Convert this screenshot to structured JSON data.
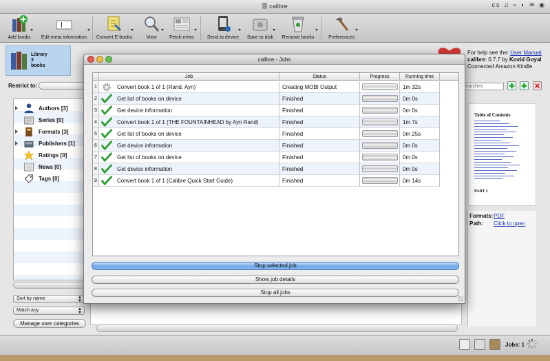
{
  "app": {
    "title": "calibre",
    "menubar_extras": "cs ♫ ⌁ ◐ ✉ ◉"
  },
  "toolbar": {
    "add_books": "Add books",
    "edit_meta": "Edit meta information",
    "convert": "Convert E-books",
    "view": "View",
    "fetch_news": "Fetch news",
    "send_device": "Send to device",
    "save_disk": "Save to disk",
    "remove": "Remove books",
    "preferences": "Preferences"
  },
  "library": {
    "label": "Library",
    "count": "3",
    "unit": "books"
  },
  "restrict": {
    "label": "Restrict to:"
  },
  "tag_browser": {
    "items": [
      {
        "label": "Authors [3]",
        "expandable": true,
        "icon": "user-icon"
      },
      {
        "label": "Series [0]",
        "expandable": false,
        "icon": "series-icon"
      },
      {
        "label": "Formats [3]",
        "expandable": true,
        "icon": "book-icon"
      },
      {
        "label": "Publishers [1]",
        "expandable": true,
        "icon": "publisher-icon"
      },
      {
        "label": "Ratings [0]",
        "expandable": false,
        "icon": "star-icon"
      },
      {
        "label": "News [0]",
        "expandable": false,
        "icon": "news-icon"
      },
      {
        "label": "Tags [0]",
        "expandable": false,
        "icon": "tag-icon"
      }
    ]
  },
  "sort_combo": {
    "value": "Sort by name"
  },
  "match_combo": {
    "value": "Match any"
  },
  "manage_button": {
    "label": "Manage user categories"
  },
  "help": {
    "prefix": "For help see the:",
    "link": "User Manual",
    "version_prefix": "calibre",
    "version": ": 0.7.7 by",
    "author": "Kovid Goyal",
    "device": "Connected Amazon Kindle"
  },
  "search": {
    "placeholder": "searches"
  },
  "cover": {
    "toc_title": "Table of Contents",
    "part_label": "PART I"
  },
  "details": {
    "formats_label": "Formats:",
    "formats_value": "PDF",
    "path_label": "Path:",
    "path_value": "Click to open"
  },
  "status": {
    "jobs": "Jobs: 1"
  },
  "jobs_dialog": {
    "title": "calibre - Jobs",
    "columns": [
      "Job",
      "Status",
      "Progress",
      "Running time"
    ],
    "rows": [
      {
        "num": "1",
        "job": "Convert book 1 of 1 (Rand, Ayn)",
        "status": "Creating MOBI Output",
        "progress": 0.75,
        "time": "1m 32s",
        "icon": "gear-icon"
      },
      {
        "num": "2",
        "job": "Get list of books on device",
        "status": "Finished",
        "progress": 1.0,
        "time": "0m 0s",
        "icon": "check-icon"
      },
      {
        "num": "3",
        "job": "Get device information",
        "status": "Finished",
        "progress": 1.0,
        "time": "0m 0s",
        "icon": "check-icon"
      },
      {
        "num": "4",
        "job": "Convert book 1 of 1 (THE FOUNTAINHEAD by Ayn Rand)",
        "status": "Finished",
        "progress": 1.0,
        "time": "1m 7s",
        "icon": "check-icon"
      },
      {
        "num": "5",
        "job": "Get list of books on device",
        "status": "Finished",
        "progress": 1.0,
        "time": "0m 25s",
        "icon": "check-icon"
      },
      {
        "num": "6",
        "job": "Get device information",
        "status": "Finished",
        "progress": 1.0,
        "time": "0m 0s",
        "icon": "check-icon"
      },
      {
        "num": "7",
        "job": "Get list of books on device",
        "status": "Finished",
        "progress": 1.0,
        "time": "0m 0s",
        "icon": "check-icon"
      },
      {
        "num": "8",
        "job": "Get device information",
        "status": "Finished",
        "progress": 1.0,
        "time": "0m 0s",
        "icon": "check-icon"
      },
      {
        "num": "9",
        "job": "Convert book 1 of 1 (Calibre Quick Start Guide)",
        "status": "Finished",
        "progress": 1.0,
        "time": "0m 14s",
        "icon": "check-icon"
      }
    ],
    "buttons": {
      "stop_selected": "Stop selected job",
      "show_details": "Show job details",
      "stop_all": "Stop all jobs"
    }
  },
  "colors": {
    "accent": "#6fa7e6",
    "check": "#2f9e2f",
    "link": "#1a33b3",
    "selection": "#b9d4ef"
  }
}
